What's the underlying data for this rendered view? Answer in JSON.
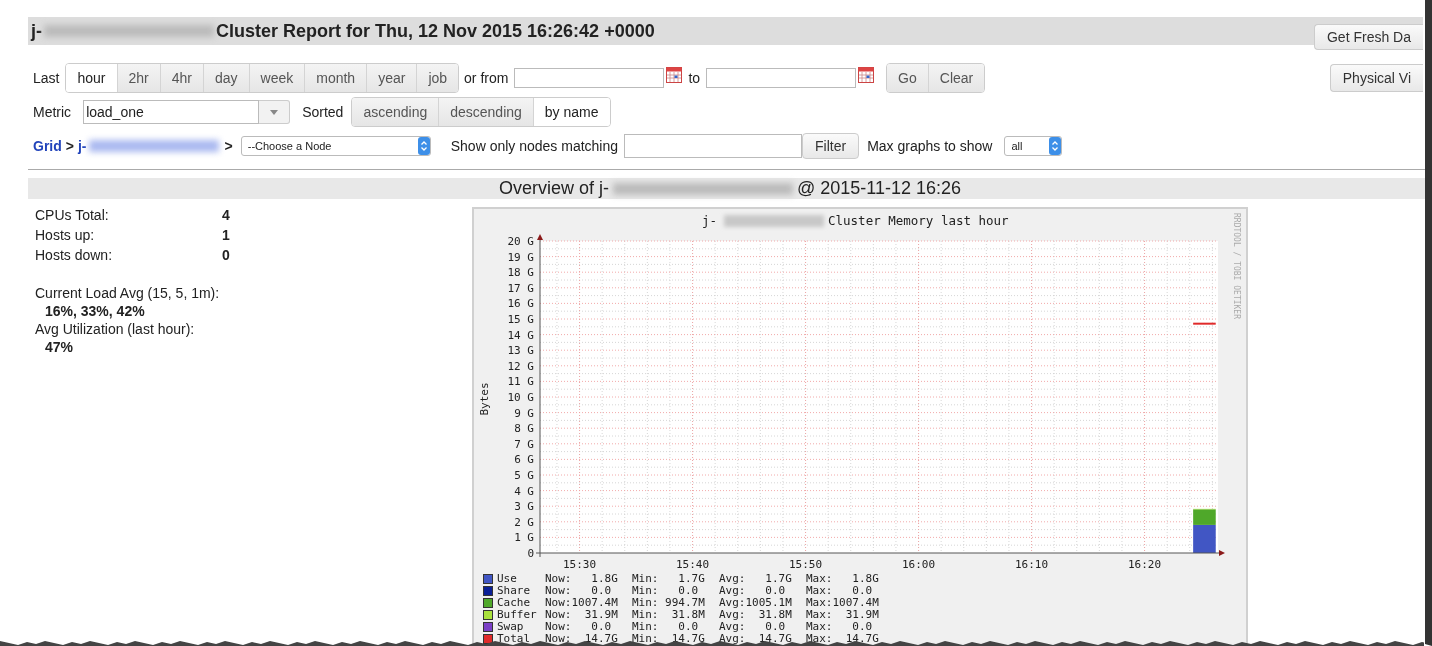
{
  "header": {
    "title_prefix": "j-",
    "title": "Cluster Report for Thu, 12 Nov 2015 16:26:42 +0000",
    "fresh_button": "Get Fresh Da"
  },
  "range": {
    "label": "Last",
    "options": [
      {
        "label": "hour",
        "selected": true
      },
      {
        "label": "2hr",
        "selected": false
      },
      {
        "label": "4hr",
        "selected": false
      },
      {
        "label": "day",
        "selected": false
      },
      {
        "label": "week",
        "selected": false
      },
      {
        "label": "month",
        "selected": false
      },
      {
        "label": "year",
        "selected": false
      },
      {
        "label": "job",
        "selected": false
      }
    ],
    "from_label": "or from",
    "to_label": "to",
    "go_button": "Go",
    "clear_button": "Clear",
    "physical_button": "Physical Vi"
  },
  "metric": {
    "label": "Metric",
    "value": "load_one",
    "sorted_label": "Sorted",
    "sort_options": [
      {
        "label": "ascending",
        "selected": false
      },
      {
        "label": "descending",
        "selected": false
      },
      {
        "label": "by name",
        "selected": true
      }
    ]
  },
  "nav": {
    "grid_link": "Grid",
    "separator_1": ">",
    "cluster_prefix": "j-",
    "separator_2": ">",
    "node_select": "--Choose a Node",
    "filter_label": "Show only nodes matching",
    "filter_button": "Filter",
    "max_label": "Max graphs to show",
    "max_value": "all"
  },
  "overview": {
    "prefix": "Overview of j-",
    "suffix": "@ 2015-11-12 16:26"
  },
  "stats": [
    {
      "label": "CPUs Total:",
      "value": "4"
    },
    {
      "label": "Hosts up:",
      "value": "1"
    },
    {
      "label": "Hosts down:",
      "value": "0"
    }
  ],
  "load": [
    {
      "label": "Current Load Avg (15, 5, 1m):",
      "value": "16%, 33%, 42%"
    },
    {
      "label": "Avg Utilization (last hour):",
      "value": "47%"
    }
  ],
  "graph": {
    "title_prefix": "j-",
    "credit": "RRDTOOL / TOBI OETIKER",
    "chart_data": {
      "type": "area",
      "title": "Cluster Memory last hour",
      "ylabel": "Bytes",
      "stacked": true,
      "grid": true,
      "x": [
        984.3,
        986.3
      ],
      "xlim": [
        926.5,
        986.5
      ],
      "ylim": [
        0,
        20
      ],
      "xticks": [
        {
          "value": 930,
          "label": "15:30"
        },
        {
          "value": 940,
          "label": "15:40"
        },
        {
          "value": 950,
          "label": "15:50"
        },
        {
          "value": 960,
          "label": "16:00"
        },
        {
          "value": 970,
          "label": "16:10"
        },
        {
          "value": 980,
          "label": "16:20"
        }
      ],
      "yticks": [
        {
          "value": 0,
          "label": "0"
        },
        {
          "value": 1,
          "label": "1 G"
        },
        {
          "value": 2,
          "label": "2 G"
        },
        {
          "value": 3,
          "label": "3 G"
        },
        {
          "value": 4,
          "label": "4 G"
        },
        {
          "value": 5,
          "label": "5 G"
        },
        {
          "value": 6,
          "label": "6 G"
        },
        {
          "value": 7,
          "label": "7 G"
        },
        {
          "value": 8,
          "label": "8 G"
        },
        {
          "value": 9,
          "label": "9 G"
        },
        {
          "value": 10,
          "label": "10 G"
        },
        {
          "value": 11,
          "label": "11 G"
        },
        {
          "value": 12,
          "label": "12 G"
        },
        {
          "value": 13,
          "label": "13 G"
        },
        {
          "value": 14,
          "label": "14 G"
        },
        {
          "value": 15,
          "label": "15 G"
        },
        {
          "value": 16,
          "label": "16 G"
        },
        {
          "value": 17,
          "label": "17 G"
        },
        {
          "value": 18,
          "label": "18 G"
        },
        {
          "value": 19,
          "label": "19 G"
        },
        {
          "value": 20,
          "label": "20 G"
        }
      ],
      "series": [
        {
          "name": "Use",
          "type": "area",
          "color": "#4156c4",
          "values": [
            1.8,
            1.8
          ]
        },
        {
          "name": "Share",
          "type": "area",
          "color": "#0a1f96",
          "values": [
            null,
            null
          ]
        },
        {
          "name": "Cache",
          "type": "area",
          "color": "#4fa82a",
          "values": [
            1.0,
            1.0
          ]
        },
        {
          "name": "Buffer",
          "type": "area",
          "color": "#a9e23c",
          "values": [
            0.03,
            0.03
          ]
        },
        {
          "name": "Swap",
          "type": "area",
          "color": "#7b3fc6",
          "values": [
            null,
            null
          ]
        },
        {
          "name": "Total",
          "type": "line",
          "color": "#e02a2a",
          "values": [
            14.7,
            14.7
          ]
        }
      ]
    },
    "legend": [
      {
        "now": "Now:   1.8G",
        "min": "Min:   1.7G",
        "avg": "Avg:   1.7G",
        "max": "Max:   1.8G"
      },
      {
        "now": "Now:   0.0",
        "min": "Min:   0.0",
        "avg": "Avg:   0.0",
        "max": "Max:   0.0"
      },
      {
        "now": "Now:1007.4M",
        "min": "Min: 994.7M",
        "avg": "Avg:1005.1M",
        "max": "Max:1007.4M"
      },
      {
        "now": "Now:  31.9M",
        "min": "Min:  31.8M",
        "avg": "Avg:  31.8M",
        "max": "Max:  31.9M"
      },
      {
        "now": "Now:   0.0",
        "min": "Min:   0.0",
        "avg": "Avg:   0.0",
        "max": "Max:   0.0"
      },
      {
        "now": "Now:  14.7G",
        "min": "Min:  14.7G",
        "avg": "Avg:  14.7G",
        "max": "Max:  14.7G"
      }
    ]
  }
}
